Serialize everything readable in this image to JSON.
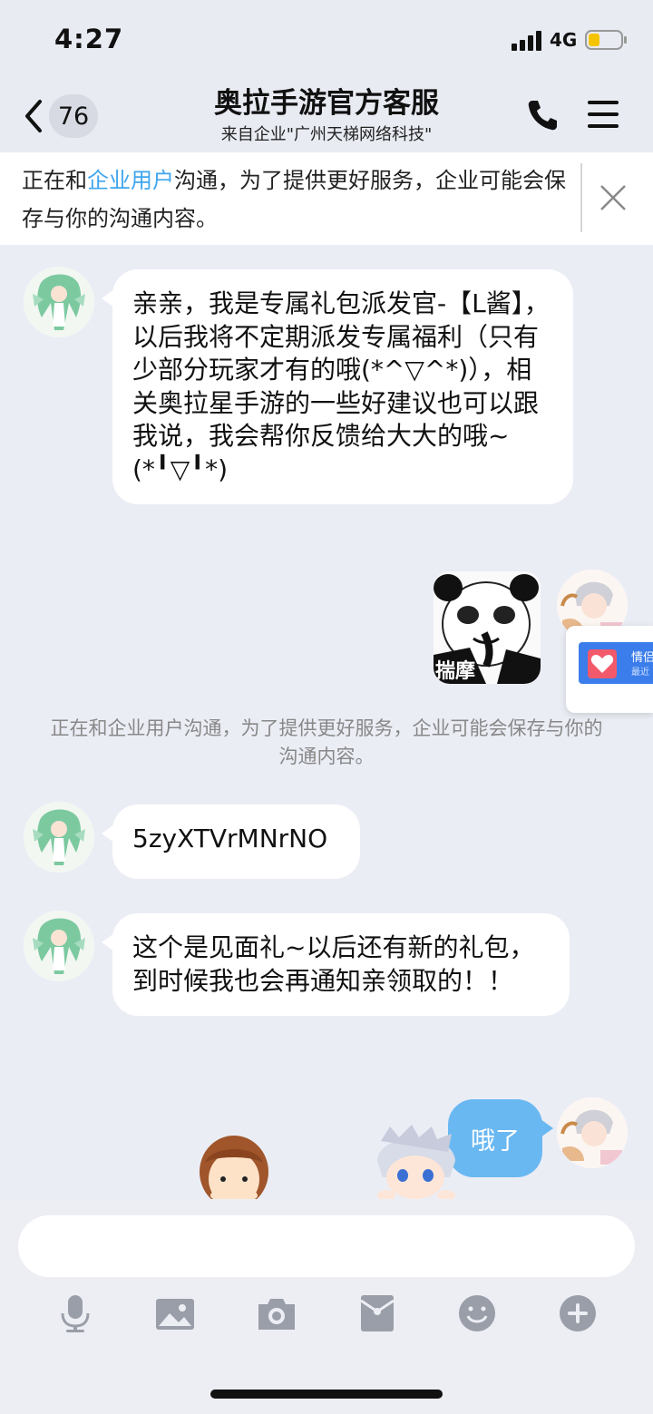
{
  "status_bar": {
    "time": "4:27",
    "network": "4G"
  },
  "header": {
    "back_count": "76",
    "title": "奥拉手游官方客服",
    "subtitle": "来自企业\"广州天梯网络科技\""
  },
  "notice": {
    "prefix": "正在和",
    "link": "企业用户",
    "suffix": "沟通，为了提供更好服务，企业可能会保存与你的沟通内容。"
  },
  "messages": {
    "m1": "亲亲，我是专属礼包派发官-【L酱】，以后我将不定期派发专属福利（只有少部分玩家才有的哦(*^▽^*)），相关奥拉星手游的一些好建议也可以跟我说，我会帮你反馈给大大的哦~(*╹▽╹*)",
    "sticker_caption": "揣摩",
    "system": "正在和企业用户沟通，为了提供更好服务，企业可能会保存与你的沟通内容。",
    "m2": "5zyXTVrMNrNO",
    "m3": "这个是见面礼~以后还有新的礼包，到时候我也会再通知亲领取的！！",
    "sent": "哦了"
  },
  "floating_card": {
    "title": "情侣",
    "subtitle": "最近"
  },
  "toolbar": {
    "icons": [
      "microphone-icon",
      "image-icon",
      "camera-icon",
      "red-packet-icon",
      "emoji-icon",
      "plus-icon"
    ]
  },
  "colors": {
    "accent": "#3ea5ee",
    "sent_bubble": "#6ab8f2",
    "background": "#ebedf5"
  }
}
